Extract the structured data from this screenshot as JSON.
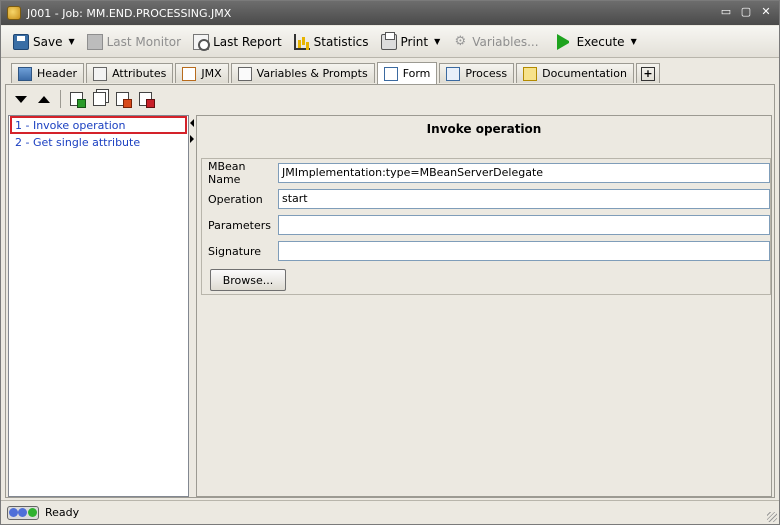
{
  "window": {
    "title": "J001 - Job: MM.END.PROCESSING.JMX",
    "controls": [
      "▭",
      "▢",
      "✕"
    ]
  },
  "toolbar": {
    "items": [
      {
        "label": "Save",
        "icon": "save-icon",
        "dropdown": true,
        "enabled": true
      },
      {
        "label": "Last Monitor",
        "icon": "monitor-icon",
        "dropdown": false,
        "enabled": false
      },
      {
        "label": "Last Report",
        "icon": "report-icon",
        "dropdown": false,
        "enabled": true
      },
      {
        "label": "Statistics",
        "icon": "statistics-icon",
        "dropdown": false,
        "enabled": true
      },
      {
        "label": "Print",
        "icon": "print-icon",
        "dropdown": true,
        "enabled": true
      },
      {
        "label": "Variables...",
        "icon": "variables-icon",
        "dropdown": false,
        "enabled": false
      },
      {
        "label": "Execute",
        "icon": "execute-icon",
        "dropdown": true,
        "enabled": true
      }
    ]
  },
  "tabs": [
    {
      "label": "Header",
      "icon": "header-icon",
      "active": false
    },
    {
      "label": "Attributes",
      "icon": "attributes-icon",
      "active": false
    },
    {
      "label": "JMX",
      "icon": "jmx-icon",
      "active": false
    },
    {
      "label": "Variables & Prompts",
      "icon": "variables-prompts-icon",
      "active": false
    },
    {
      "label": "Form",
      "icon": "form-icon",
      "active": true
    },
    {
      "label": "Process",
      "icon": "process-icon",
      "active": false
    },
    {
      "label": "Documentation",
      "icon": "documentation-icon",
      "active": false
    }
  ],
  "list": {
    "items": [
      {
        "label": "1 - Invoke operation",
        "selected": true
      },
      {
        "label": "2 - Get single attribute",
        "selected": false
      }
    ]
  },
  "form": {
    "title": "Invoke operation",
    "fields": {
      "mbean_name": {
        "label": "MBean Name",
        "value": "JMImplementation:type=MBeanServerDelegate"
      },
      "operation": {
        "label": "Operation",
        "value": "start"
      },
      "parameters": {
        "label": "Parameters",
        "value": ""
      },
      "signature": {
        "label": "Signature",
        "value": ""
      }
    },
    "browse_label": "Browse..."
  },
  "status": {
    "text": "Ready",
    "lights": [
      "#4f6fd8",
      "#4f6fd8",
      "#2fb12f"
    ]
  },
  "colors": {
    "link": "#1a3fc1",
    "selection_border": "#d4222a"
  }
}
